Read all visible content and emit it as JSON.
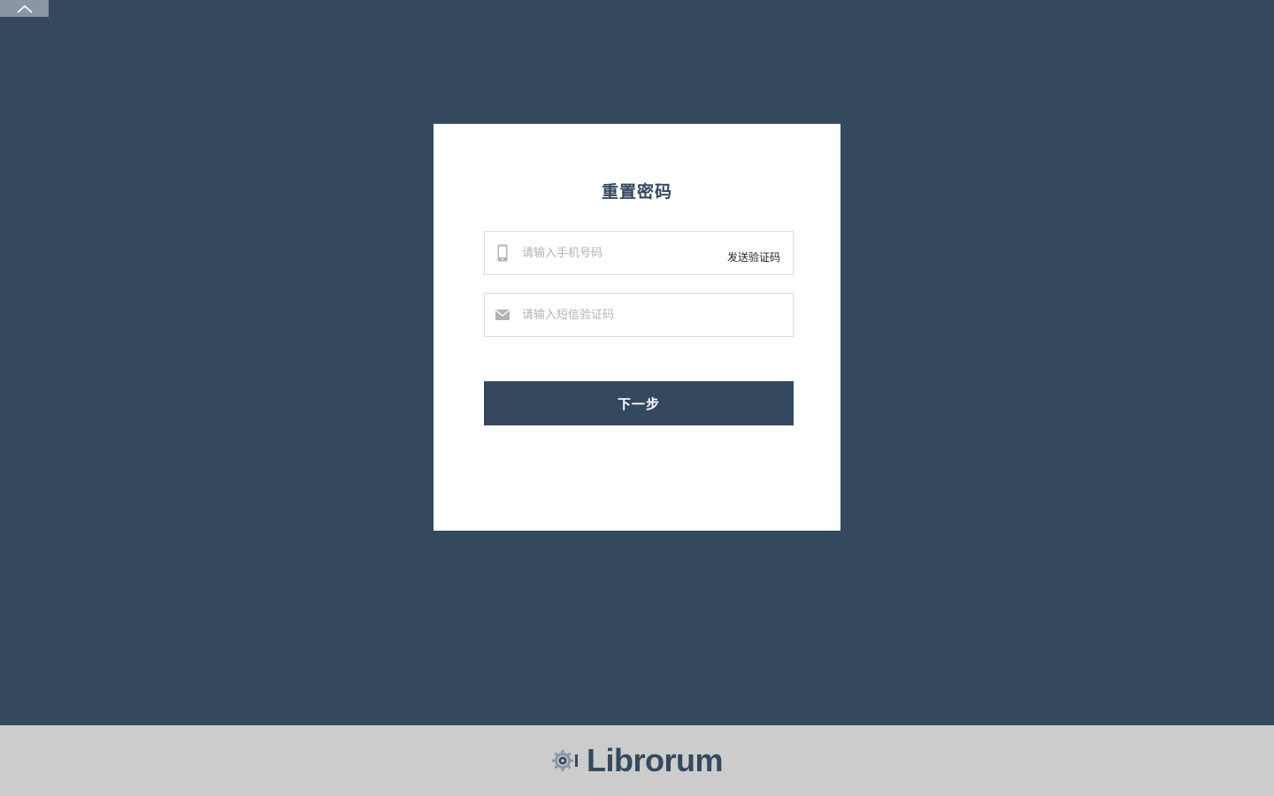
{
  "top_bar": {
    "collapse_icon": "chevron-up-icon"
  },
  "form": {
    "title": "重置密码",
    "phone": {
      "icon": "mobile-phone-icon",
      "placeholder": "请输入手机号码",
      "value": "",
      "send_code_label": "发送验证码"
    },
    "sms": {
      "icon": "envelope-icon",
      "placeholder": "请输入短信验证码",
      "value": ""
    },
    "next_label": "下一步"
  },
  "footer": {
    "logo_icon": "gear-logo-icon",
    "brand": "Librorum"
  },
  "colors": {
    "background": "#34495e",
    "card": "#ffffff",
    "footer": "#cccccc",
    "button": "#34495e",
    "icon_gray": "#b3b3b3"
  }
}
